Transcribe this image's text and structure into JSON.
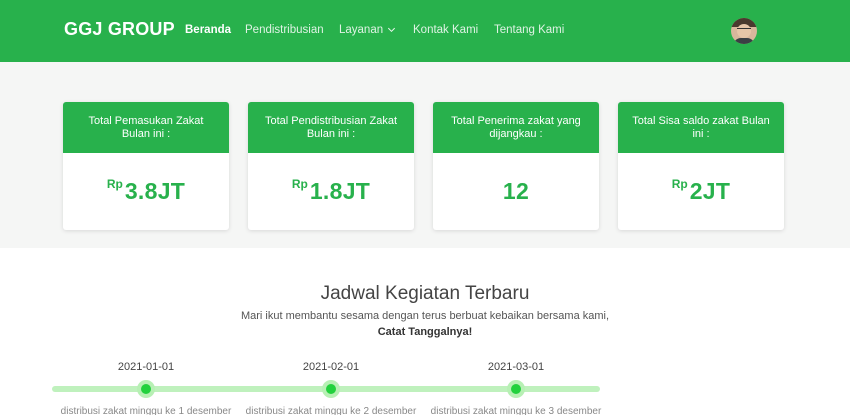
{
  "navbar": {
    "brand": "GGJ GROUP",
    "items": [
      {
        "label": "Beranda",
        "active": true
      },
      {
        "label": "Pendistribusian"
      },
      {
        "label": "Layanan",
        "dropdown": true
      },
      {
        "label": "Kontak Kami"
      },
      {
        "label": "Tentang Kami"
      }
    ],
    "dropdown_icon": "chevron-down-icon",
    "avatar_icon": "user-avatar",
    "brand_color": "#28b14c"
  },
  "stats": [
    {
      "title": "Total Pemasukan Zakat Bulan ini :",
      "currency": "Rp",
      "value": "3.8JT"
    },
    {
      "title": "Total Pendistribusian Zakat Bulan ini :",
      "currency": "Rp",
      "value": "1.8JT"
    },
    {
      "title": "Total Penerima zakat yang dijangkau :",
      "currency": "",
      "value": "12"
    },
    {
      "title": "Total Sisa saldo zakat Bulan ini :",
      "currency": "Rp",
      "value": "2JT"
    }
  ],
  "schedule": {
    "title": "Jadwal Kegiatan Terbaru",
    "subtitle": "Mari ikut membantu sesama dengan terus berbuat kebaikan bersama kami,",
    "cta": "Catat Tanggalnya!",
    "events": [
      {
        "date": "2021-01-01",
        "desc": "distribusi zakat minggu ke 1 desember"
      },
      {
        "date": "2021-02-01",
        "desc": "distribusi zakat minggu ke 2 desember"
      },
      {
        "date": "2021-03-01",
        "desc": "distribusi zakat minggu ke 3 desember"
      }
    ]
  }
}
